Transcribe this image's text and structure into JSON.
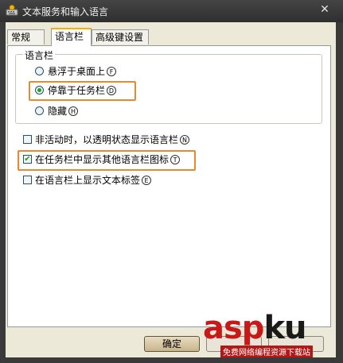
{
  "window": {
    "title": "文本服务和输入语言",
    "close_glyph": "✕"
  },
  "tabs": [
    {
      "label": "常规",
      "active": false
    },
    {
      "label": "语言栏",
      "active": true
    },
    {
      "label": "高级键设置",
      "active": false
    }
  ],
  "groupbox": {
    "legend": "语言栏",
    "options": [
      {
        "label": "悬浮于桌面上",
        "mnemonic": "F",
        "selected": false
      },
      {
        "label": "停靠于任务栏",
        "mnemonic": "D",
        "selected": true
      },
      {
        "label": "隐藏",
        "mnemonic": "H",
        "selected": false
      }
    ]
  },
  "checkboxes": [
    {
      "label": "非活动时，以透明状态显示语言栏",
      "mnemonic": "N",
      "checked": false
    },
    {
      "label": "在任务栏中显示其他语言栏图标",
      "mnemonic": "T",
      "checked": true
    },
    {
      "label": "在语言栏上显示文本标签",
      "mnemonic": "E",
      "checked": false
    }
  ],
  "buttons": {
    "ok_label": "确定"
  },
  "watermark": {
    "brand": "asp",
    "brand_suffix": "ku",
    "tagline": "免费网络编程资源下载站"
  },
  "colors": {
    "highlight": "#e8892e",
    "tab_accent": "#f5b000",
    "watermark_red": "#c81818",
    "watermark_dark": "#1a1a1a"
  }
}
